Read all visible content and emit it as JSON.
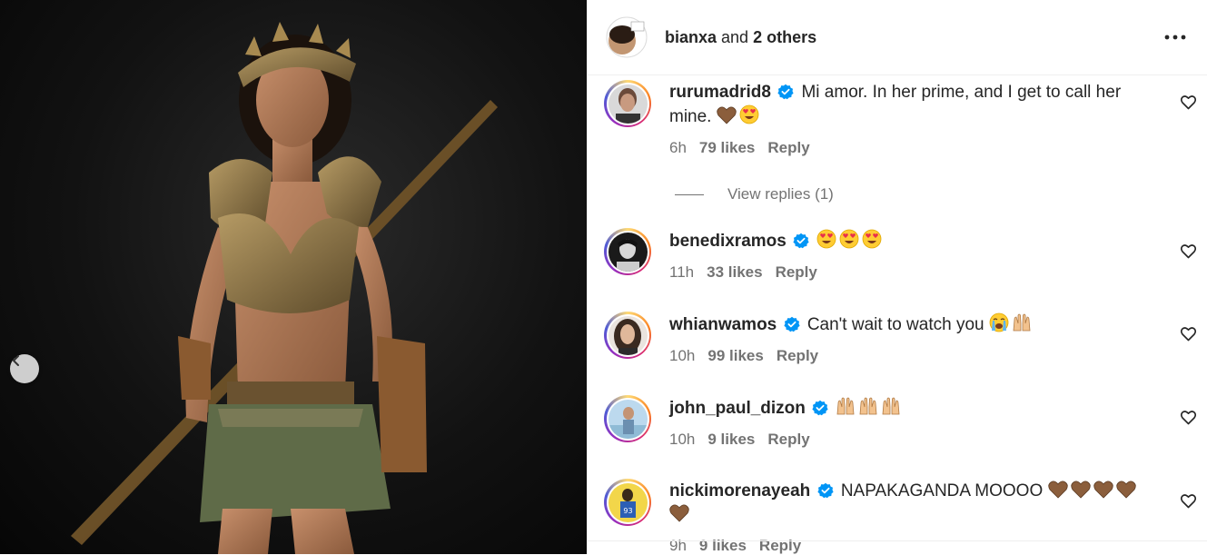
{
  "post_header": {
    "author": "bianxa",
    "and_text": " and ",
    "others": "2 others"
  },
  "icons": {
    "more": "more-options-icon",
    "like": "heart-outline-icon",
    "verified": "verified-badge-icon",
    "prev": "chevron-left-icon"
  },
  "colors": {
    "verified_blue": "#0095f6",
    "meta_grey": "#737373",
    "text": "#262626"
  },
  "comments": [
    {
      "username": "rurumadrid8",
      "verified": true,
      "text": "Mi amor. In her prime, and I get to call her mine.",
      "emojis": [
        "brown-heart",
        "heart-eyes"
      ],
      "time": "6h",
      "likes": "79 likes",
      "reply": "Reply",
      "view_replies": "View replies (1)"
    },
    {
      "username": "benedixramos",
      "verified": true,
      "text": "",
      "emojis": [
        "heart-eyes",
        "heart-eyes",
        "heart-eyes"
      ],
      "time": "11h",
      "likes": "33 likes",
      "reply": "Reply"
    },
    {
      "username": "whianwamos",
      "verified": true,
      "text": "Can't wait to watch you",
      "emojis": [
        "crying",
        "raised-hands"
      ],
      "time": "10h",
      "likes": "99 likes",
      "reply": "Reply"
    },
    {
      "username": "john_paul_dizon",
      "verified": true,
      "text": "",
      "emojis": [
        "raised-hands",
        "raised-hands",
        "raised-hands"
      ],
      "time": "10h",
      "likes": "9 likes",
      "reply": "Reply"
    },
    {
      "username": "nickimorenayeah",
      "verified": true,
      "text": "NAPAKAGANDA MOOOO",
      "emojis": [
        "brown-heart",
        "brown-heart",
        "brown-heart",
        "brown-heart",
        "brown-heart"
      ],
      "time": "9h",
      "likes": "9 likes",
      "reply": "Reply"
    }
  ]
}
